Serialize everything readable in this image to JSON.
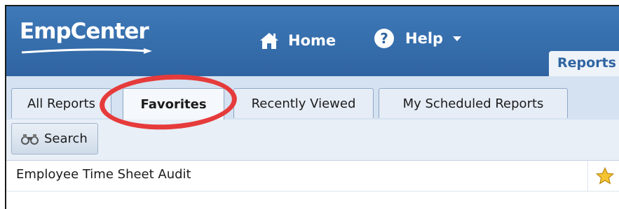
{
  "header": {
    "logo_text": "EmpCenter",
    "nav": {
      "home_label": "Home",
      "home_icon": "home-icon",
      "help_label": "Help",
      "help_icon": "question-circle-icon"
    },
    "top_tab_label": "Reports"
  },
  "tabs": [
    {
      "label": "All Reports",
      "active": false
    },
    {
      "label": "Favorites",
      "active": true
    },
    {
      "label": "Recently Viewed",
      "active": false
    },
    {
      "label": "My Scheduled Reports",
      "active": false
    }
  ],
  "toolbar": {
    "search_label": "Search",
    "search_icon": "binoculars-icon"
  },
  "rows": [
    {
      "label": "Employee Time Sheet Audit",
      "favorite": true,
      "favorite_icon": "star-icon"
    }
  ],
  "colors": {
    "header_blue": "#2f64a1",
    "highlight_red": "#e63b3b",
    "star_yellow": "#f5c431"
  }
}
